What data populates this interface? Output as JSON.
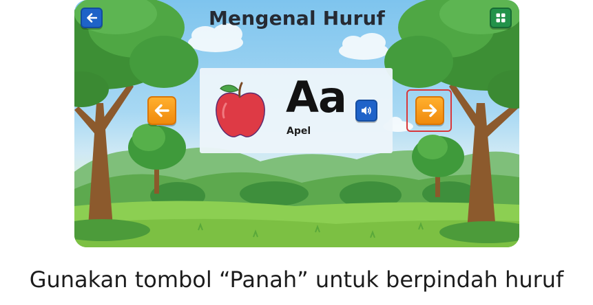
{
  "game": {
    "title": "Mengenal Huruf",
    "card": {
      "letter": "Aa",
      "word": "Apel",
      "image_icon": "apple-icon"
    },
    "icons": {
      "back": "arrow-left-icon",
      "menu": "grid-icon",
      "sound": "speaker-icon",
      "prev": "arrow-left-icon",
      "next": "arrow-right-icon"
    },
    "colors": {
      "blue_button": "#1e63c8",
      "green_button": "#23924a",
      "orange_button": "#f59a18",
      "highlight": "#d9373a"
    }
  },
  "caption": "Gunakan tombol “Panah” untuk berpindah huruf"
}
